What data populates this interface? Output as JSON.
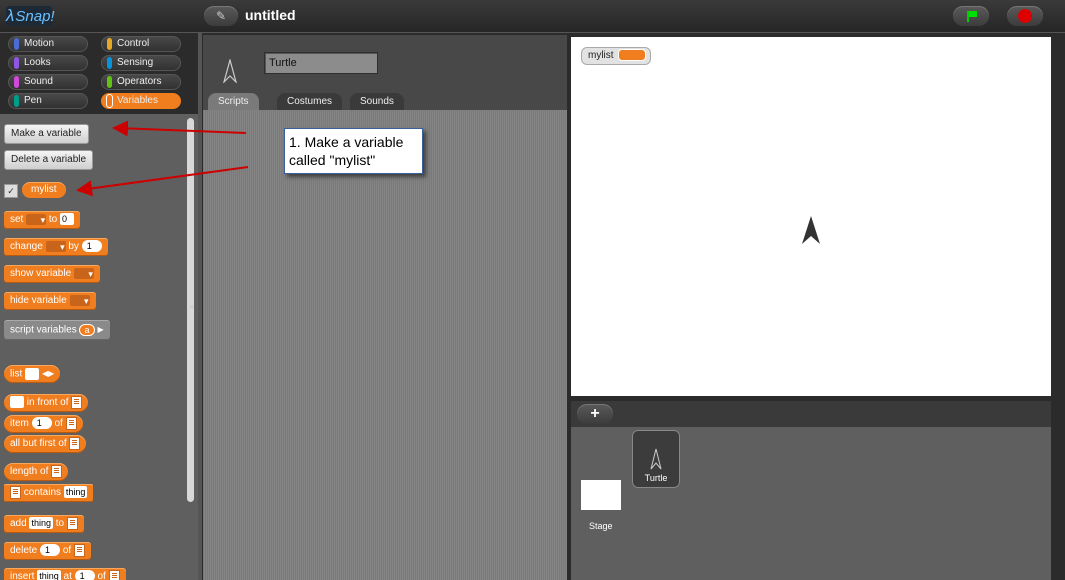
{
  "app": {
    "logo": "Snap!",
    "project_title": "untitled"
  },
  "categories": [
    {
      "label": "Motion",
      "color": "#4a6cd4"
    },
    {
      "label": "Control",
      "color": "#e6a822"
    },
    {
      "label": "Looks",
      "color": "#8f56e3"
    },
    {
      "label": "Sensing",
      "color": "#0494dc"
    },
    {
      "label": "Sound",
      "color": "#cf4ad9"
    },
    {
      "label": "Operators",
      "color": "#62c213"
    },
    {
      "label": "Pen",
      "color": "#009d8c"
    },
    {
      "label": "Variables",
      "color": "#f37618"
    }
  ],
  "palette": {
    "make_variable": "Make a variable",
    "delete_variable": "Delete a variable",
    "variable_name": "mylist",
    "checkbox_mark": "✓",
    "set": {
      "label": "set",
      "to": "to",
      "value": "0"
    },
    "change": {
      "label": "change",
      "by": "by",
      "value": "1"
    },
    "show_variable": "show variable",
    "hide_variable": "hide variable",
    "script_variables": {
      "label": "script variables",
      "arg": "a"
    },
    "list": "list",
    "in_front_of": "in front of",
    "item": {
      "label": "item",
      "value": "1",
      "of": "of"
    },
    "all_but_first_of": "all but first of",
    "length_of": "length of",
    "contains": {
      "label": "contains",
      "value": "thing"
    },
    "add": {
      "label": "add",
      "value": "thing",
      "to": "to"
    },
    "delete": {
      "label": "delete",
      "value": "1",
      "of": "of"
    },
    "insert": {
      "label": "insert",
      "value": "thing",
      "at": "at",
      "index": "1",
      "of": "of"
    }
  },
  "sprite": {
    "name": "Turtle"
  },
  "tabs": [
    "Scripts",
    "Costumes",
    "Sounds"
  ],
  "stage": {
    "watcher_label": "mylist"
  },
  "corral": {
    "stage_label": "Stage",
    "sprite_label": "Turtle",
    "add_button": "+"
  },
  "annotation": {
    "line1": "1. Make a variable",
    "line2": "called \"mylist\""
  }
}
